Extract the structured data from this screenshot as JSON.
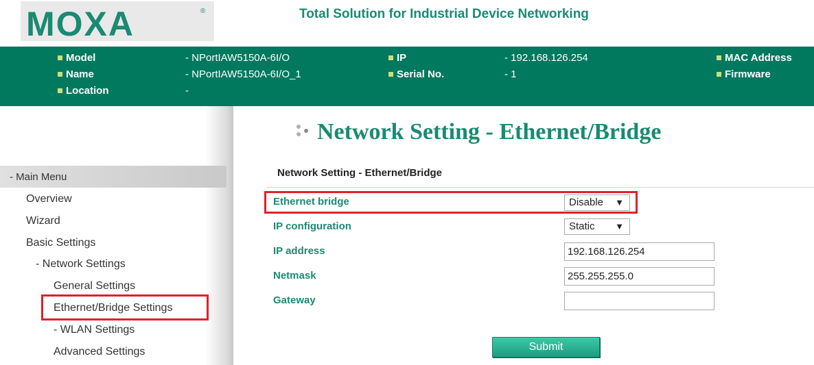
{
  "header": {
    "logo_text": "MOXA",
    "logo_mark": "®",
    "tagline": "Total Solution for Industrial Device Networking"
  },
  "info": {
    "model_label": "Model",
    "model_value": "- NPortIAW5150A-6I/O",
    "name_label": "Name",
    "name_value": "- NPortIAW5150A-6I/O_1",
    "location_label": "Location",
    "location_value": "-",
    "ip_label": "IP",
    "ip_value": "- 192.168.126.254",
    "serial_label": "Serial No.",
    "serial_value": "- 1",
    "mac_label": "MAC Address",
    "firmware_label": "Firmware"
  },
  "sidebar": {
    "header": "- Main Menu",
    "items": [
      "Overview",
      "Wizard",
      "Basic Settings",
      "- Network Settings",
      "General Settings",
      "Ethernet/Bridge Settings",
      "- WLAN Settings",
      "Advanced Settings"
    ]
  },
  "main": {
    "page_title": "Network Setting - Ethernet/Bridge",
    "section_title": "Network Setting - Ethernet/Bridge",
    "fields": {
      "ethernet_bridge_label": "Ethernet bridge",
      "ethernet_bridge_value": "Disable",
      "ip_config_label": "IP configuration",
      "ip_config_value": "Static",
      "ip_address_label": "IP address",
      "ip_address_value": "192.168.126.254",
      "netmask_label": "Netmask",
      "netmask_value": "255.255.255.0",
      "gateway_label": "Gateway",
      "gateway_value": ""
    },
    "submit_label": "Submit",
    "dropdown_arrow": "▼"
  },
  "colors": {
    "brand_green": "#1a8a72",
    "infobar_bg": "#00795e",
    "highlight_red": "#e0202a"
  }
}
